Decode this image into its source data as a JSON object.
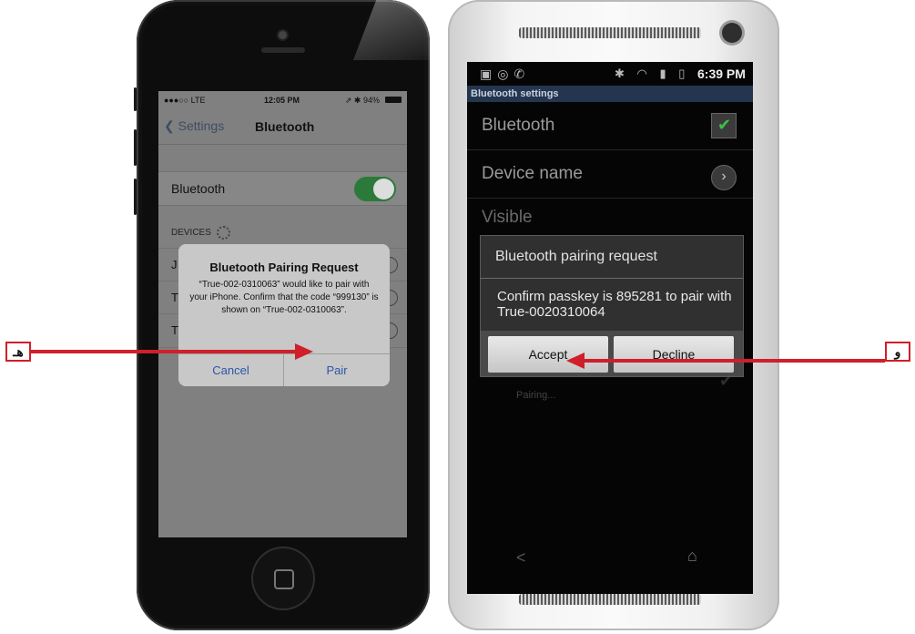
{
  "iphone": {
    "status": {
      "carrier": "●●●○○ LTE",
      "time": "12:05 PM",
      "battery": "⇗ ✱ 94%"
    },
    "nav": {
      "back_label": "❮ Settings",
      "title": "Bluetooth"
    },
    "bluetooth_row_label": "Bluetooth",
    "devices_header": "DEVICES",
    "device_rows": [
      "J",
      "Ti",
      "Ti"
    ],
    "alert": {
      "title": "Bluetooth Pairing Request",
      "message": "“True-002-0310063” would like to pair with your iPhone. Confirm that the code “999130” is shown on “True-002-0310063”.",
      "cancel_label": "Cancel",
      "pair_label": "Pair"
    }
  },
  "android": {
    "status": {
      "time": "6:39 PM"
    },
    "header": "Bluetooth settings",
    "rows": {
      "bluetooth": "Bluetooth",
      "device_name": "Device name",
      "visible": "Visible"
    },
    "dialog": {
      "title": "Bluetooth pairing request",
      "message": "Confirm passkey is 895281 to pair with True-0020310064",
      "accept_label": "Accept",
      "decline_label": "Decline"
    },
    "pairing_status": "Pairing..."
  },
  "callouts": {
    "left": "هـ",
    "right": "و"
  },
  "colors": {
    "callout_red": "#d01f2a",
    "ios_link": "#2d55a8",
    "ios_toggle_on": "#2b7a3a",
    "android_header": "#24354f"
  }
}
